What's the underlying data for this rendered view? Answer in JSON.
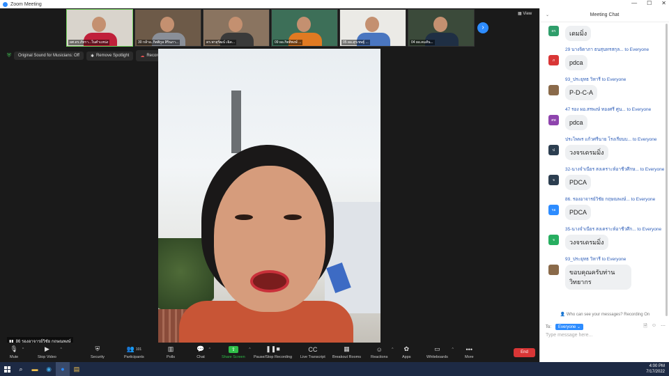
{
  "window": {
    "title": "Zoom Meeting"
  },
  "gallery": {
    "tiles": [
      {
        "name": "ผศ.ดร.ภัทรา...ในตำแหน่ง",
        "shirt": "#c0203a",
        "bg": "#d9d4cc",
        "active": true
      },
      {
        "name": "30 กล้าอ..กิตติกูล สิรินภา...",
        "shirt": "#8a8f98",
        "bg": "#6d5a48",
        "active": false
      },
      {
        "name": "ดร.พาสุรัฒน์ เฉิด...",
        "shirt": "#3a3a3a",
        "bg": "#8a7460",
        "active": false
      },
      {
        "name": "09 ผอ.กิตติพงษ์ ...",
        "shirt": "#e07a22",
        "bg": "#3d6f58",
        "active": false
      },
      {
        "name": "05 ผอ.สุรเชษฐ์ ...",
        "shirt": "#4a76c0",
        "bg": "#ebeae6",
        "active": false
      },
      {
        "name": "04 ผอ.คมสัน...",
        "shirt": "#1f2f44",
        "bg": "#3b4a3a",
        "active": false
      }
    ],
    "next_arrow": "›",
    "view_label": "View"
  },
  "status": {
    "original_sound": "Original Sound for Musicians: Off",
    "remove_spotlight": "Remove Spotlight",
    "recording": "Recording..."
  },
  "speaker": {
    "name": "86 รองอาจารย์วิชัย กฤษณพงษ์"
  },
  "toolbar": {
    "mute": "Mute",
    "stop_video": "Stop Video",
    "security": "Security",
    "participants": "Participants",
    "participants_count": "101",
    "polls": "Polls",
    "chat": "Chat",
    "share_screen": "Share Screen",
    "pause_recording": "Pause/Stop Recording",
    "live_transcript": "Live Transcript",
    "breakout_rooms": "Breakout Rooms",
    "reactions": "Reactions",
    "apps": "Apps",
    "whiteboards": "Whiteboards",
    "more": "More",
    "end": "End"
  },
  "chat": {
    "title": "Meeting Chat",
    "messages": [
      {
        "sender": "",
        "text": "เดมมิ่ง",
        "avatar": "ดร",
        "avatar_color": "#2f9e6b"
      },
      {
        "sender": "29 นางจิดาภา ธนสุนทรสกุล... to Everyone",
        "text": "pdca",
        "avatar": "ภ",
        "avatar_color": "#d93636"
      },
      {
        "sender": "93_ประยุทธ วิหารี to Everyone",
        "text": "P-D-C-A",
        "avatar": "",
        "avatar_color": "#8a6a4a"
      },
      {
        "sender": "47 รอง ผอ.สรพงษ์ ทองศรี ศูน... to Everyone",
        "text": "pdca",
        "avatar": "ศพ",
        "avatar_color": "#8e44ad"
      },
      {
        "sender": "ประไพพร แก้วศรีนาย โรงเรียนบ... to Everyone",
        "text": "วงจรเดรมมิ่ง",
        "avatar": "ป",
        "avatar_color": "#2c3e50"
      },
      {
        "sender": "32-นางจำเนียร สงเคราะห์อาชีวศึกษ... to Everyone",
        "text": "PDCA",
        "avatar": "จ",
        "avatar_color": "#2c3e50"
      },
      {
        "sender": "86. รองอาจารย์วิชัย กฤษณพงษ์... to Everyone",
        "text": "PDCA",
        "avatar": "รอ",
        "avatar_color": "#2d8cff"
      },
      {
        "sender": "35-นางจำเนียร สงเคราะห์อาชีวศึก... to Everyone",
        "text": "วงจรเดรมมิ่ง",
        "avatar": "จ",
        "avatar_color": "#27ae60"
      },
      {
        "sender": "93_ประยุทธ วิหารี to Everyone",
        "text": "ขอบคุณครับท่านวิทยากร",
        "avatar": "",
        "avatar_color": "#8a6a4a"
      }
    ],
    "who_can_see": "Who can see your messages? Recording On",
    "to_label": "To:",
    "to_target": "Everyone",
    "placeholder": "Type message here..."
  },
  "taskbar": {
    "time": "4:00 PM",
    "date": "7/17/2022"
  }
}
